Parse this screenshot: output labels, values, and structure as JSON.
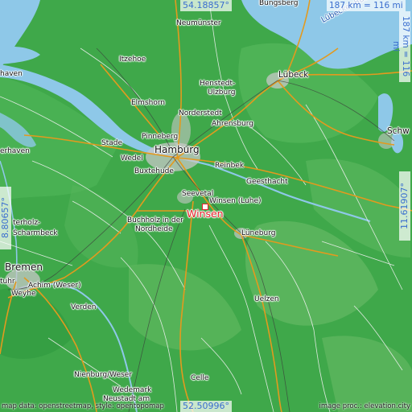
{
  "coords": {
    "top": "54.18857°",
    "bottom": "52.50996°",
    "left": "8.80657°",
    "right": "11.61907°"
  },
  "scale": {
    "horizontal": "187 km = 116 mi",
    "vertical": "187 km = 116 mi"
  },
  "target_city": "Winsen",
  "labels": {
    "bungsberg": "Bungsberg",
    "neumunster": "Neumünster",
    "itzehoe": "Itzehoe",
    "henstedt": "Henstedt-",
    "ulzburg": "Ulzburg",
    "lubeck": "Lübeck",
    "lubecker_bucht": "Lübecker Bucht",
    "bremerhaven": "erhaven",
    "elmshorn": "Elmshorn",
    "norderstedt": "Norderstedt",
    "ahrensburg": "Ahrensburg",
    "pinneberg": "Pinneberg",
    "hamburg": "Hamburg",
    "stade": "Stade",
    "wedel": "Wedel",
    "buxtehude": "Buxtehude",
    "reinbek": "Reinbek",
    "geesthacht": "Geesthacht",
    "schwerin": "Schw",
    "seevetal": "Seevetal",
    "winsen_luhe": "Winsen (Luhe)",
    "buchholz_1": "Buchholz in der",
    "buchholz_2": "Nordheide",
    "osterholz_1": "terholz-",
    "osterholz_2": "Scharmbeck",
    "luneburg": "Lüneburg",
    "bremen": "Bremen",
    "delmenhorst": "tuhr",
    "achim": "Achim (Weser)",
    "weyhe": "Weyhe",
    "verden": "Verden",
    "uelzen": "Uelzen",
    "nienburg": "Nienburg/Weser",
    "celle": "Celle",
    "wedemark": "Wedemark",
    "neustadt": "Neustadt am",
    "haven_left": "haven"
  },
  "credits": {
    "left": "map data: openstreetmap, style: opentopomap",
    "right": "image proc.: elevation.city"
  },
  "colors": {
    "lowland": "#3fa84a",
    "water": "#8ec8e8",
    "road_major": "#e39a1e",
    "road_minor": "#f1f1f1",
    "urban": "#c8c8c8",
    "accent": "#3a6ecf",
    "target": "#e8202a"
  }
}
